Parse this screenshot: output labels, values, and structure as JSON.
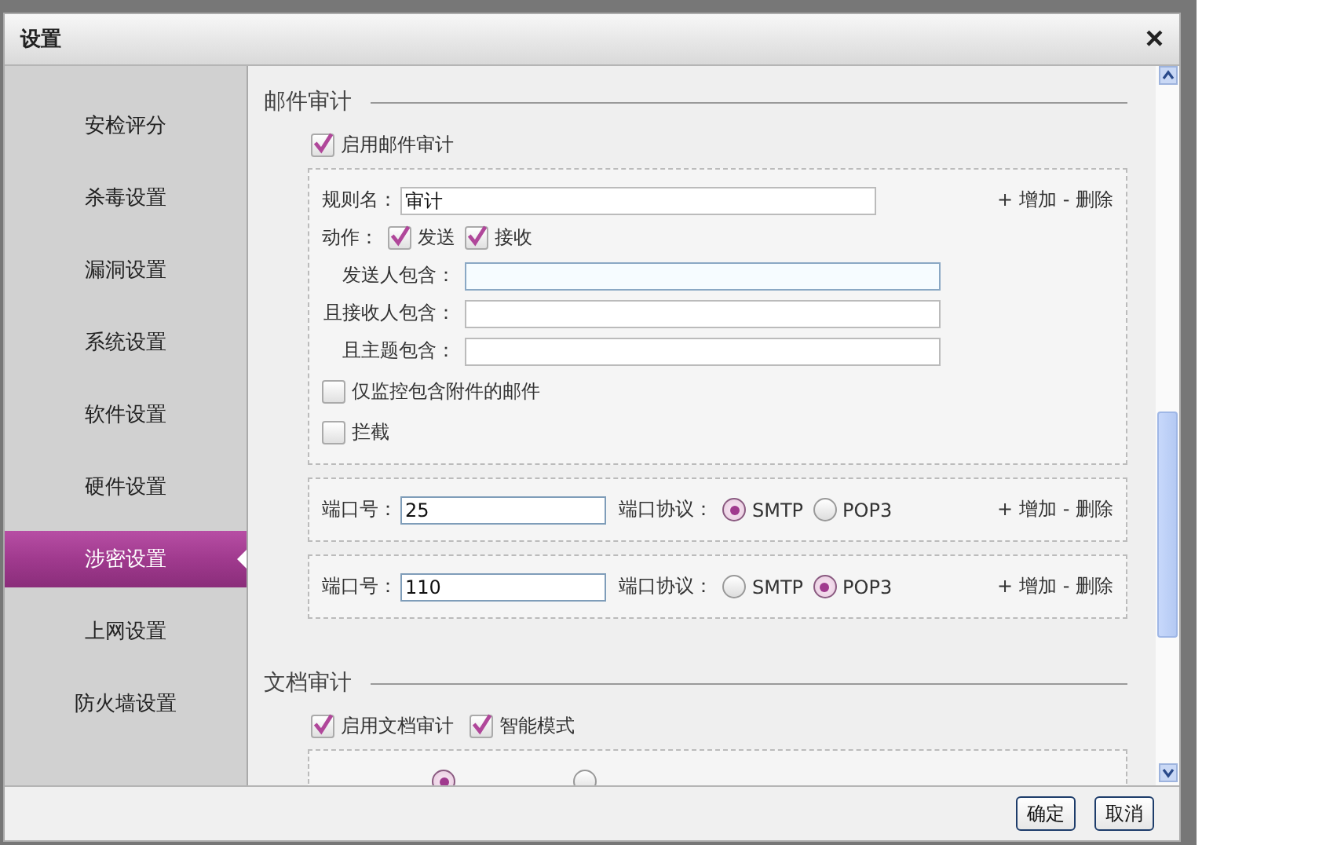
{
  "window": {
    "title": "设置",
    "close": "×"
  },
  "sidebar": {
    "items": [
      {
        "label": "安检评分",
        "selected": false
      },
      {
        "label": "杀毒设置",
        "selected": false
      },
      {
        "label": "漏洞设置",
        "selected": false
      },
      {
        "label": "系统设置",
        "selected": false
      },
      {
        "label": "软件设置",
        "selected": false
      },
      {
        "label": "硬件设置",
        "selected": false
      },
      {
        "label": "涉密设置",
        "selected": true
      },
      {
        "label": "上网设置",
        "selected": false
      },
      {
        "label": "防火墙设置",
        "selected": false
      }
    ]
  },
  "sections": [
    {
      "title": "邮件审计",
      "toggles": [
        {
          "label": "启用邮件审计",
          "checked": true
        }
      ],
      "rules": [
        {
          "kind": "filter",
          "name_label": "规则名：",
          "name_value": "审计",
          "actions_label": "动作：",
          "actions": [
            {
              "label": "发送",
              "checked": true
            },
            {
              "label": "接收",
              "checked": true
            }
          ],
          "fields": [
            {
              "label": "发送人包含："
            },
            {
              "label": "且接收人包含："
            },
            {
              "label": "且主题包含："
            }
          ],
          "options": [
            {
              "label": "仅监控包含附件的邮件",
              "checked": false
            },
            {
              "label": "拦截",
              "checked": false
            }
          ],
          "add": "+ 增加",
          "delete": "- 删除"
        },
        {
          "kind": "port",
          "port_label": "端口号：",
          "port_value": "25",
          "protocol_label": "端口协议：",
          "protocols": [
            {
              "label": "SMTP",
              "selected": true
            },
            {
              "label": "POP3",
              "selected": false
            }
          ],
          "add": "+ 增加",
          "delete": "- 删除"
        },
        {
          "kind": "port",
          "port_label": "端口号：",
          "port_value": "110",
          "protocol_label": "端口协议：",
          "protocols": [
            {
              "label": "SMTP",
              "selected": false
            },
            {
              "label": "POP3",
              "selected": true
            }
          ],
          "add": "+ 增加",
          "delete": "- 删除"
        }
      ]
    },
    {
      "title": "文档审计",
      "toggles": [
        {
          "label": "启用文档审计",
          "checked": true
        },
        {
          "label": "智能模式",
          "checked": true
        }
      ],
      "rules": [
        {
          "kind": "audit_type",
          "types": [
            {
              "selected": true
            },
            {
              "selected": false
            }
          ]
        }
      ]
    }
  ],
  "buttons": [
    "确定",
    "取消"
  ]
}
